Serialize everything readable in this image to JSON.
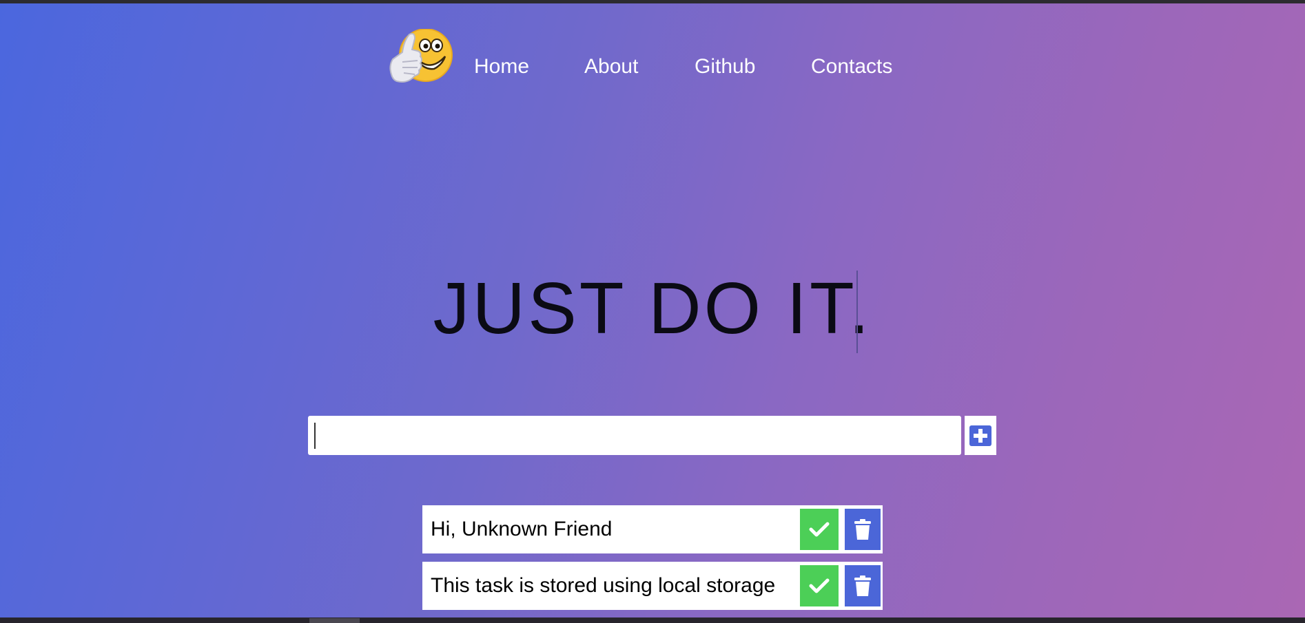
{
  "nav": {
    "logo_icon": "thumbs-up-grinning-emoji-icon",
    "links": [
      "Home",
      "About",
      "Github",
      "Contacts"
    ]
  },
  "hero": {
    "title": "JUST DO IT."
  },
  "task_form": {
    "input_value": "",
    "add_icon": "plus-square-icon"
  },
  "tasks": [
    {
      "text": "Hi, Unknown Friend",
      "done_icon": "checkmark-icon",
      "delete_icon": "trash-icon"
    },
    {
      "text": "This task is stored using local storage",
      "done_icon": "checkmark-icon",
      "delete_icon": "trash-icon"
    }
  ],
  "colors": {
    "gradient_start": "#4b67de",
    "gradient_end": "#aa67b4",
    "done_button": "#4ccf57",
    "delete_button": "#4b66d8",
    "hero_text": "#0b0b14"
  }
}
